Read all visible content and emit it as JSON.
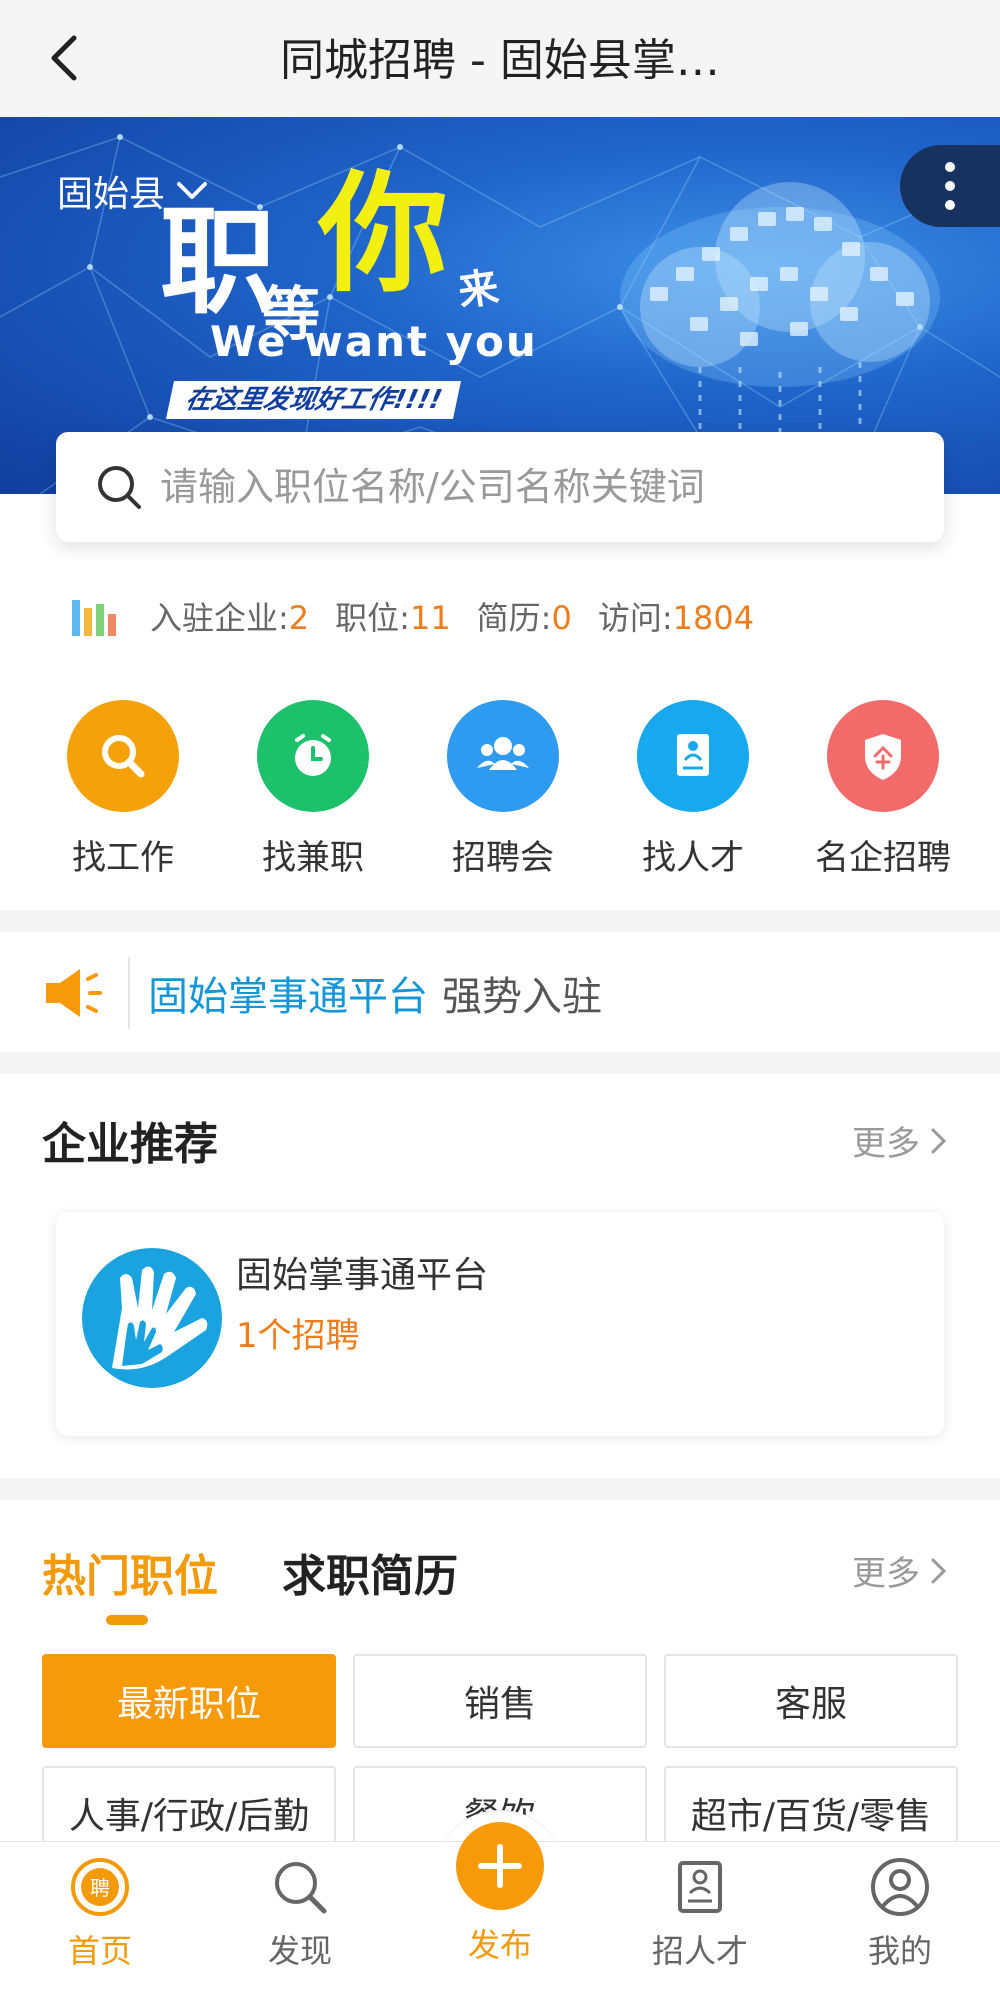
{
  "header": {
    "title": "同城招聘 - 固始县掌…"
  },
  "banner": {
    "city": "固始县",
    "slogan_zhi": "职",
    "slogan_deng": "等",
    "slogan_ni": "你",
    "slogan_lai": "来",
    "slogan_en": "We want you",
    "slogan_tag": "在这里发现好工作!!!!"
  },
  "search": {
    "placeholder": "请输入职位名称/公司名称关键词"
  },
  "stats": [
    {
      "label": "入驻企业:",
      "value": "2"
    },
    {
      "label": "职位:",
      "value": "11"
    },
    {
      "label": "简历:",
      "value": "0"
    },
    {
      "label": "访问:",
      "value": "1804"
    }
  ],
  "quick_links": [
    {
      "label": "找工作",
      "icon": "search-icon",
      "color": "#f5a20a"
    },
    {
      "label": "找兼职",
      "icon": "clock-icon",
      "color": "#1ec16b"
    },
    {
      "label": "招聘会",
      "icon": "people-icon",
      "color": "#2e9af0"
    },
    {
      "label": "找人才",
      "icon": "resume-icon",
      "color": "#17a8ee"
    },
    {
      "label": "名企招聘",
      "icon": "company-shield-icon",
      "color": "#f26b6b"
    }
  ],
  "notice": {
    "highlight": "固始掌事通平台",
    "text": "强势入驻"
  },
  "company_section": {
    "title": "企业推荐",
    "more": "更多",
    "company": {
      "name": "固始掌事通平台",
      "jobs": "1个招聘"
    }
  },
  "jobs_section": {
    "tab_active": "热门职位",
    "tab_inactive": "求职简历",
    "more": "更多",
    "categories": [
      "最新职位",
      "销售",
      "客服",
      "人事/行政/后勤",
      "餐饮",
      "超市/百货/零售"
    ]
  },
  "tabbar": {
    "items": [
      "首页",
      "发现",
      "发布",
      "招人才",
      "我的"
    ],
    "badge": "聘"
  },
  "colors": {
    "accent": "#f39a0b",
    "link": "#1496d8",
    "number": "#ef7d1b"
  }
}
